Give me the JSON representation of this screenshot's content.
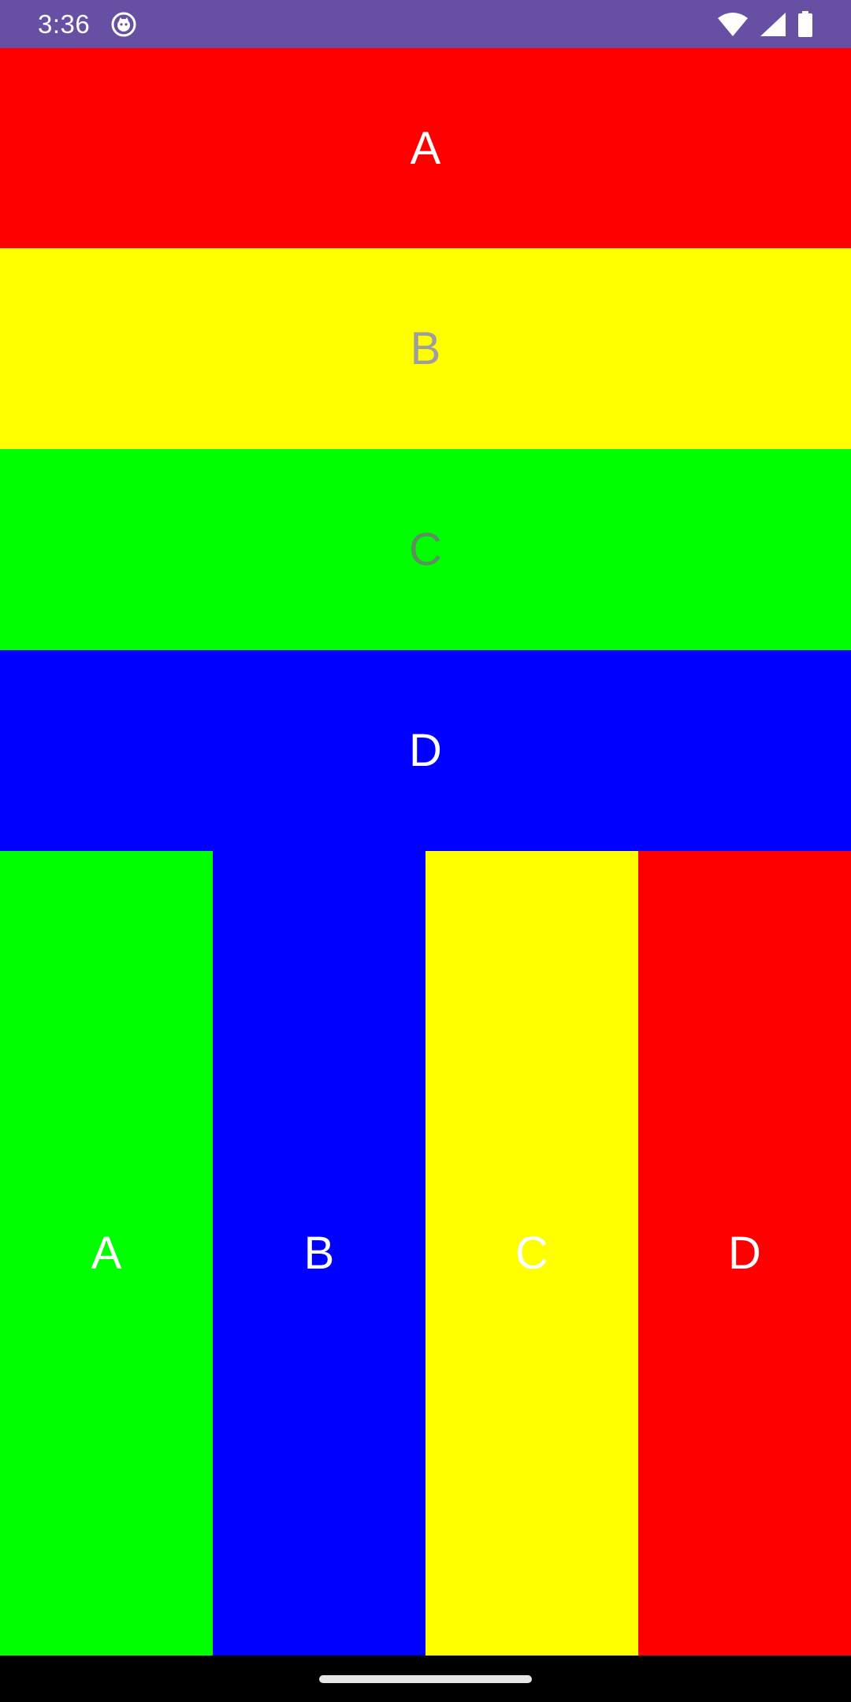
{
  "status_bar": {
    "time": "3:36",
    "background": "#6750A4",
    "icons": [
      "app-notification-icon",
      "wifi-icon",
      "cell-signal-icon",
      "battery-icon"
    ]
  },
  "rows": [
    {
      "label": "A",
      "color": "#FF0000",
      "text_color": "#FFFFFF"
    },
    {
      "label": "B",
      "color": "#FFFF00",
      "text_color": "#9E9E9E"
    },
    {
      "label": "C",
      "color": "#00FF00",
      "text_color": "#5E8F5E"
    },
    {
      "label": "D",
      "color": "#0000FF",
      "text_color": "#FFFFFF"
    }
  ],
  "columns": [
    {
      "label": "A",
      "color": "#00FF00",
      "text_color": "#FFFFFF"
    },
    {
      "label": "B",
      "color": "#0000FF",
      "text_color": "#FFFFFF"
    },
    {
      "label": "C",
      "color": "#FFFF00",
      "text_color": "#FFFFFF"
    },
    {
      "label": "D",
      "color": "#FF0000",
      "text_color": "#FFFFFF"
    }
  ],
  "nav_bar": {
    "icon": "home-handle-icon"
  }
}
